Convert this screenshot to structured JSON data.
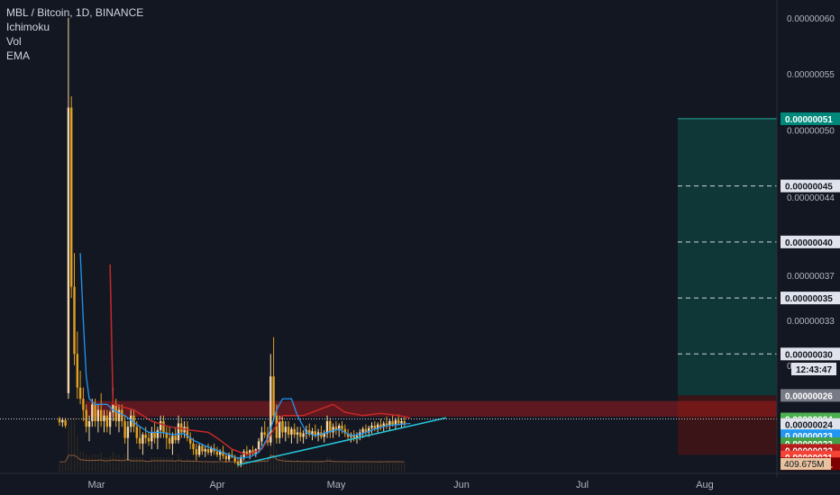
{
  "legend": {
    "symbol": "MBL / Bitcoin, 1D, BINANCE",
    "indicators": [
      "Ichimoku",
      "Vol",
      "EMA"
    ]
  },
  "colors": {
    "background": "#131722",
    "up_candle": "#f5d7a5",
    "down_candle": "#e2a01f",
    "tenkan": "#2196f3",
    "kijun": "#c62828",
    "channel_fill": "#8b1a1a",
    "target_zone": "#0f3b3a",
    "trendline": "#26c6da",
    "volume_ema": "#8d5a3a"
  },
  "chart_data": {
    "type": "candlestick",
    "title": "MBL / Bitcoin, 1D, BINANCE",
    "xlabel": "",
    "ylabel": "",
    "ylim": [
      1.9e-07,
      6.1e-07
    ],
    "x_ticks": [
      "Mar",
      "Apr",
      "May",
      "Jun",
      "Jul",
      "Aug"
    ],
    "y_ticks": [
      "0.00000060",
      "0.00000055",
      "0.00000050",
      "0.00000044",
      "0.00000037",
      "0.00000033",
      "0.00000029"
    ],
    "y_tick_values": [
      60,
      55,
      50,
      44,
      37,
      33,
      29
    ],
    "price_labels": [
      {
        "text": "0.00000051",
        "value": 51,
        "color": "#00897b"
      },
      {
        "text": "0.00000045",
        "value": 45,
        "color": "#e0e3eb"
      },
      {
        "text": "0.00000040",
        "value": 40,
        "color": "#e0e3eb"
      },
      {
        "text": "0.00000035",
        "value": 35,
        "color": "#e0e3eb"
      },
      {
        "text": "0.00000030",
        "value": 30,
        "color": "#e0e3eb"
      },
      {
        "text": "0.00000026",
        "value": 26.3,
        "color": "#787b86"
      },
      {
        "text": "0.00000024",
        "value": 24.2,
        "color": "#4caf50"
      },
      {
        "text": "0.00000024",
        "value": 23.7,
        "color": "#e0e3eb"
      },
      {
        "text": "0.00000023",
        "value": 22.7,
        "color": "#2196f3"
      },
      {
        "text": "0.00000022",
        "value": 22.0,
        "color": "#43a047"
      },
      {
        "text": "0.00000022",
        "value": 21.4,
        "color": "#b71c1c"
      },
      {
        "text": "0.00000021",
        "value": 20.8,
        "color": "#f44336"
      },
      {
        "text": "0.00000021",
        "value": 20.2,
        "color": "#7f0000"
      }
    ],
    "countdown": "12:43:47",
    "volume_label": "409.675M",
    "candles": [
      {
        "o": 24.2,
        "h": 24.4,
        "l": 23.6,
        "c": 23.9
      },
      {
        "o": 23.9,
        "h": 24.3,
        "l": 23.5,
        "c": 24.1
      },
      {
        "o": 24.1,
        "h": 24.3,
        "l": 23.4,
        "c": 23.6
      },
      {
        "o": 26.5,
        "h": 60.0,
        "l": 26.0,
        "c": 52.0
      },
      {
        "o": 52.0,
        "h": 53.0,
        "l": 35.0,
        "c": 36.0
      },
      {
        "o": 36.0,
        "h": 39.0,
        "l": 29.0,
        "c": 30.0
      },
      {
        "o": 30.0,
        "h": 32.0,
        "l": 26.0,
        "c": 27.0
      },
      {
        "o": 27.0,
        "h": 28.5,
        "l": 25.5,
        "c": 26.0
      },
      {
        "o": 26.0,
        "h": 27.0,
        "l": 24.0,
        "c": 25.0
      },
      {
        "o": 25.0,
        "h": 25.5,
        "l": 23.0,
        "c": 23.5
      },
      {
        "o": 23.5,
        "h": 24.5,
        "l": 22.2,
        "c": 24.0
      },
      {
        "o": 24.0,
        "h": 26.0,
        "l": 23.5,
        "c": 25.5
      },
      {
        "o": 25.5,
        "h": 26.0,
        "l": 23.5,
        "c": 24.0
      },
      {
        "o": 24.0,
        "h": 25.5,
        "l": 23.0,
        "c": 25.0
      },
      {
        "o": 25.0,
        "h": 26.5,
        "l": 23.5,
        "c": 24.0
      },
      {
        "o": 24.0,
        "h": 25.0,
        "l": 23.0,
        "c": 24.5
      },
      {
        "o": 24.5,
        "h": 25.0,
        "l": 23.0,
        "c": 23.5
      },
      {
        "o": 23.5,
        "h": 25.0,
        "l": 22.8,
        "c": 24.8
      },
      {
        "o": 24.8,
        "h": 27.0,
        "l": 24.0,
        "c": 25.5
      },
      {
        "o": 25.5,
        "h": 26.0,
        "l": 23.5,
        "c": 24.0
      },
      {
        "o": 24.0,
        "h": 25.5,
        "l": 23.0,
        "c": 25.0
      },
      {
        "o": 25.0,
        "h": 25.5,
        "l": 23.5,
        "c": 24.0
      },
      {
        "o": 24.0,
        "h": 24.5,
        "l": 22.0,
        "c": 22.5
      },
      {
        "o": 22.5,
        "h": 24.0,
        "l": 20.5,
        "c": 23.5
      },
      {
        "o": 23.5,
        "h": 25.0,
        "l": 23.0,
        "c": 24.5
      },
      {
        "o": 24.5,
        "h": 25.0,
        "l": 23.0,
        "c": 23.5
      },
      {
        "o": 23.5,
        "h": 24.0,
        "l": 22.0,
        "c": 22.5
      },
      {
        "o": 22.5,
        "h": 23.5,
        "l": 21.5,
        "c": 22.0
      },
      {
        "o": 22.0,
        "h": 23.0,
        "l": 21.0,
        "c": 22.8
      },
      {
        "o": 22.8,
        "h": 23.5,
        "l": 22.0,
        "c": 22.5
      },
      {
        "o": 22.5,
        "h": 23.0,
        "l": 21.8,
        "c": 22.2
      },
      {
        "o": 22.2,
        "h": 23.5,
        "l": 21.5,
        "c": 23.0
      },
      {
        "o": 23.0,
        "h": 24.0,
        "l": 22.0,
        "c": 22.5
      },
      {
        "o": 22.5,
        "h": 23.5,
        "l": 21.5,
        "c": 23.2
      },
      {
        "o": 23.2,
        "h": 24.5,
        "l": 22.5,
        "c": 24.0
      },
      {
        "o": 24.0,
        "h": 24.5,
        "l": 22.5,
        "c": 23.0
      },
      {
        "o": 23.0,
        "h": 23.5,
        "l": 21.5,
        "c": 22.5
      },
      {
        "o": 22.5,
        "h": 23.5,
        "l": 21.5,
        "c": 22.0
      },
      {
        "o": 22.0,
        "h": 23.0,
        "l": 21.0,
        "c": 22.7
      },
      {
        "o": 22.7,
        "h": 23.5,
        "l": 22.0,
        "c": 22.3
      },
      {
        "o": 22.3,
        "h": 24.5,
        "l": 22.0,
        "c": 23.8
      },
      {
        "o": 23.8,
        "h": 24.3,
        "l": 22.5,
        "c": 23.0
      },
      {
        "o": 23.0,
        "h": 24.0,
        "l": 22.5,
        "c": 23.5
      },
      {
        "o": 23.5,
        "h": 24.0,
        "l": 22.2,
        "c": 22.5
      },
      {
        "o": 22.5,
        "h": 23.0,
        "l": 21.5,
        "c": 22.0
      },
      {
        "o": 22.0,
        "h": 22.5,
        "l": 21.0,
        "c": 21.5
      },
      {
        "o": 21.5,
        "h": 22.0,
        "l": 20.5,
        "c": 21.0
      },
      {
        "o": 21.0,
        "h": 22.0,
        "l": 20.8,
        "c": 21.8
      },
      {
        "o": 21.8,
        "h": 22.0,
        "l": 21.0,
        "c": 21.3
      },
      {
        "o": 21.3,
        "h": 21.8,
        "l": 20.8,
        "c": 21.5
      },
      {
        "o": 21.5,
        "h": 22.0,
        "l": 21.0,
        "c": 21.2
      },
      {
        "o": 21.2,
        "h": 21.8,
        "l": 20.9,
        "c": 21.6
      },
      {
        "o": 21.6,
        "h": 22.0,
        "l": 21.0,
        "c": 21.3
      },
      {
        "o": 21.3,
        "h": 21.7,
        "l": 20.8,
        "c": 21.0
      },
      {
        "o": 21.0,
        "h": 21.5,
        "l": 20.5,
        "c": 21.3
      },
      {
        "o": 21.3,
        "h": 21.8,
        "l": 20.6,
        "c": 20.9
      },
      {
        "o": 20.9,
        "h": 21.2,
        "l": 20.3,
        "c": 20.6
      },
      {
        "o": 20.6,
        "h": 21.2,
        "l": 20.4,
        "c": 21.0
      },
      {
        "o": 21.0,
        "h": 21.5,
        "l": 20.7,
        "c": 20.8
      },
      {
        "o": 20.8,
        "h": 21.0,
        "l": 20.2,
        "c": 20.4
      },
      {
        "o": 20.4,
        "h": 20.8,
        "l": 19.9,
        "c": 20.1
      },
      {
        "o": 20.1,
        "h": 21.0,
        "l": 19.9,
        "c": 20.8
      },
      {
        "o": 20.8,
        "h": 21.5,
        "l": 20.5,
        "c": 21.3
      },
      {
        "o": 21.3,
        "h": 21.8,
        "l": 20.9,
        "c": 21.0
      },
      {
        "o": 21.0,
        "h": 21.5,
        "l": 20.6,
        "c": 21.4
      },
      {
        "o": 21.4,
        "h": 21.8,
        "l": 20.9,
        "c": 21.1
      },
      {
        "o": 21.1,
        "h": 21.6,
        "l": 20.8,
        "c": 21.5
      },
      {
        "o": 21.5,
        "h": 22.5,
        "l": 21.2,
        "c": 22.2
      },
      {
        "o": 22.2,
        "h": 23.5,
        "l": 21.8,
        "c": 23.0
      },
      {
        "o": 23.0,
        "h": 24.0,
        "l": 22.5,
        "c": 22.8
      },
      {
        "o": 22.8,
        "h": 23.5,
        "l": 21.8,
        "c": 22.1
      },
      {
        "o": 22.1,
        "h": 30.0,
        "l": 21.8,
        "c": 28.0
      },
      {
        "o": 28.0,
        "h": 31.5,
        "l": 24.0,
        "c": 24.5
      },
      {
        "o": 24.5,
        "h": 25.5,
        "l": 22.0,
        "c": 22.5
      },
      {
        "o": 22.5,
        "h": 24.5,
        "l": 22.0,
        "c": 24.0
      },
      {
        "o": 24.0,
        "h": 24.5,
        "l": 22.5,
        "c": 23.0
      },
      {
        "o": 23.0,
        "h": 24.0,
        "l": 22.2,
        "c": 23.5
      },
      {
        "o": 23.5,
        "h": 24.0,
        "l": 22.5,
        "c": 22.8
      },
      {
        "o": 22.8,
        "h": 23.5,
        "l": 22.0,
        "c": 23.3
      },
      {
        "o": 23.3,
        "h": 23.8,
        "l": 22.5,
        "c": 22.8
      },
      {
        "o": 22.8,
        "h": 23.5,
        "l": 22.0,
        "c": 23.0
      },
      {
        "o": 23.0,
        "h": 23.5,
        "l": 22.2,
        "c": 22.6
      },
      {
        "o": 22.6,
        "h": 23.2,
        "l": 22.0,
        "c": 22.9
      },
      {
        "o": 22.9,
        "h": 23.6,
        "l": 22.4,
        "c": 23.2
      },
      {
        "o": 23.2,
        "h": 23.8,
        "l": 22.6,
        "c": 22.8
      },
      {
        "o": 22.8,
        "h": 23.4,
        "l": 22.3,
        "c": 23.1
      },
      {
        "o": 23.1,
        "h": 23.7,
        "l": 22.5,
        "c": 22.7
      },
      {
        "o": 22.7,
        "h": 23.3,
        "l": 22.2,
        "c": 23.0
      },
      {
        "o": 23.0,
        "h": 23.6,
        "l": 22.4,
        "c": 22.6
      },
      {
        "o": 22.6,
        "h": 23.2,
        "l": 22.1,
        "c": 22.9
      },
      {
        "o": 22.9,
        "h": 24.5,
        "l": 22.5,
        "c": 24.0
      },
      {
        "o": 24.0,
        "h": 24.3,
        "l": 22.5,
        "c": 23.0
      },
      {
        "o": 23.0,
        "h": 23.8,
        "l": 22.5,
        "c": 23.5
      },
      {
        "o": 23.5,
        "h": 24.0,
        "l": 22.8,
        "c": 23.2
      },
      {
        "o": 23.2,
        "h": 23.8,
        "l": 22.6,
        "c": 23.6
      },
      {
        "o": 23.6,
        "h": 24.0,
        "l": 22.9,
        "c": 23.3
      },
      {
        "o": 23.3,
        "h": 23.7,
        "l": 22.6,
        "c": 22.9
      },
      {
        "o": 22.9,
        "h": 23.3,
        "l": 22.3,
        "c": 22.6
      },
      {
        "o": 22.6,
        "h": 23.0,
        "l": 22.1,
        "c": 22.8
      },
      {
        "o": 22.8,
        "h": 23.2,
        "l": 22.2,
        "c": 22.5
      },
      {
        "o": 22.5,
        "h": 23.0,
        "l": 22.0,
        "c": 22.7
      },
      {
        "o": 22.7,
        "h": 23.3,
        "l": 22.3,
        "c": 23.0
      },
      {
        "o": 23.0,
        "h": 23.5,
        "l": 22.5,
        "c": 23.3
      },
      {
        "o": 23.3,
        "h": 23.7,
        "l": 22.7,
        "c": 23.0
      },
      {
        "o": 23.0,
        "h": 23.6,
        "l": 22.6,
        "c": 23.4
      },
      {
        "o": 23.4,
        "h": 23.9,
        "l": 22.9,
        "c": 23.6
      },
      {
        "o": 23.6,
        "h": 24.0,
        "l": 23.1,
        "c": 23.3
      },
      {
        "o": 23.3,
        "h": 23.9,
        "l": 23.0,
        "c": 23.7
      },
      {
        "o": 23.7,
        "h": 24.2,
        "l": 23.2,
        "c": 23.5
      },
      {
        "o": 23.5,
        "h": 24.0,
        "l": 23.1,
        "c": 23.8
      },
      {
        "o": 23.8,
        "h": 24.4,
        "l": 23.3,
        "c": 23.6
      },
      {
        "o": 23.6,
        "h": 24.2,
        "l": 23.2,
        "c": 24.0
      },
      {
        "o": 24.0,
        "h": 24.5,
        "l": 23.5,
        "c": 23.7
      },
      {
        "o": 23.7,
        "h": 24.3,
        "l": 23.3,
        "c": 24.1
      },
      {
        "o": 24.1,
        "h": 24.6,
        "l": 23.6,
        "c": 23.8
      },
      {
        "o": 23.8,
        "h": 24.3,
        "l": 23.4,
        "c": 24.0
      },
      {
        "o": 24.0,
        "h": 24.4,
        "l": 23.5,
        "c": 23.7
      }
    ],
    "tenkan": [
      {
        "i": 7,
        "v": 39
      },
      {
        "i": 8,
        "v": 33
      },
      {
        "i": 9,
        "v": 28
      },
      {
        "i": 10,
        "v": 26
      },
      {
        "i": 12,
        "v": 25.5
      },
      {
        "i": 16,
        "v": 25.5
      },
      {
        "i": 18,
        "v": 25
      },
      {
        "i": 22,
        "v": 24.5
      },
      {
        "i": 26,
        "v": 23.7
      },
      {
        "i": 30,
        "v": 23.0
      },
      {
        "i": 34,
        "v": 23.0
      },
      {
        "i": 38,
        "v": 22.8
      },
      {
        "i": 42,
        "v": 22.9
      },
      {
        "i": 45,
        "v": 22.3
      },
      {
        "i": 49,
        "v": 21.8
      },
      {
        "i": 53,
        "v": 21.4
      },
      {
        "i": 57,
        "v": 21.0
      },
      {
        "i": 60,
        "v": 20.7
      },
      {
        "i": 64,
        "v": 20.8
      },
      {
        "i": 67,
        "v": 21.2
      },
      {
        "i": 70,
        "v": 22.5
      },
      {
        "i": 73,
        "v": 25.0
      },
      {
        "i": 75,
        "v": 26.0
      },
      {
        "i": 78,
        "v": 26.0
      },
      {
        "i": 80,
        "v": 24.5
      },
      {
        "i": 83,
        "v": 23.0
      },
      {
        "i": 86,
        "v": 22.7
      },
      {
        "i": 90,
        "v": 23.0
      },
      {
        "i": 94,
        "v": 23.3
      },
      {
        "i": 98,
        "v": 22.7
      },
      {
        "i": 102,
        "v": 22.9
      },
      {
        "i": 106,
        "v": 23.3
      },
      {
        "i": 110,
        "v": 23.6
      },
      {
        "i": 114,
        "v": 23.7
      },
      {
        "i": 118,
        "v": 23.8
      }
    ],
    "kijun": [
      {
        "i": 17,
        "v": 38
      },
      {
        "i": 18,
        "v": 25.5
      },
      {
        "i": 25,
        "v": 25.0
      },
      {
        "i": 31,
        "v": 24.0
      },
      {
        "i": 37,
        "v": 23.5
      },
      {
        "i": 44,
        "v": 23.2
      },
      {
        "i": 50,
        "v": 23.0
      },
      {
        "i": 53,
        "v": 22.5
      },
      {
        "i": 58,
        "v": 21.5
      },
      {
        "i": 63,
        "v": 21.0
      },
      {
        "i": 68,
        "v": 21.5
      },
      {
        "i": 71,
        "v": 22.8
      },
      {
        "i": 75,
        "v": 24.5
      },
      {
        "i": 82,
        "v": 24.5
      },
      {
        "i": 87,
        "v": 25.0
      },
      {
        "i": 92,
        "v": 25.5
      },
      {
        "i": 96,
        "v": 24.8
      },
      {
        "i": 102,
        "v": 24.5
      },
      {
        "i": 108,
        "v": 24.7
      },
      {
        "i": 114,
        "v": 24.5
      },
      {
        "i": 118,
        "v": 24.3
      }
    ],
    "channel": {
      "top": 25.8,
      "bottom": 24.4,
      "color": "#b71c1c"
    },
    "target_zone": {
      "top": 51.0,
      "bottom": 26.3
    },
    "trendline": {
      "from": {
        "i": 60,
        "v": 20.1
      },
      "to": {
        "i": 130,
        "v": 24.3
      }
    },
    "last_price": 24.2
  }
}
